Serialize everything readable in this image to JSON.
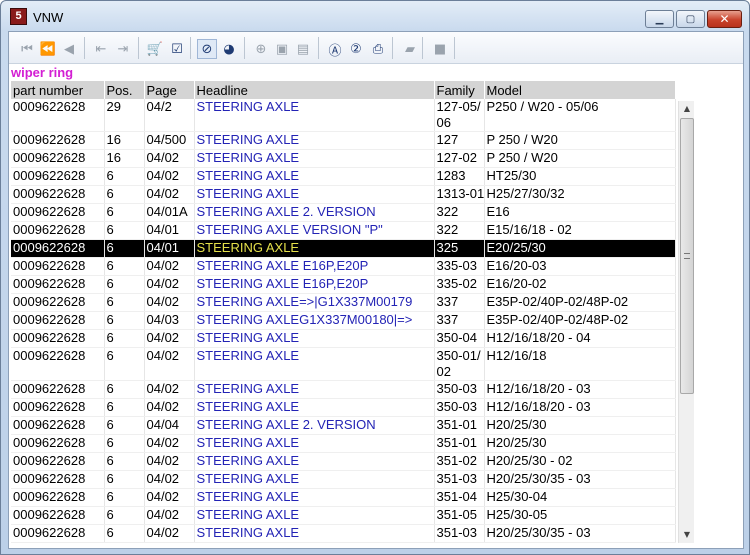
{
  "window": {
    "title": "VNW",
    "app_icon_glyph": "5"
  },
  "toolbar": {
    "buttons": [
      {
        "icon": "first-record-icon",
        "glyph": "⏮",
        "active": false
      },
      {
        "icon": "previous-page-icon",
        "glyph": "⏪",
        "active": false
      },
      {
        "icon": "previous-record-icon",
        "glyph": "◀",
        "active": false
      },
      {
        "icon": "back-document-icon",
        "glyph": "⇤",
        "active": false
      },
      {
        "icon": "forward-document-icon",
        "glyph": "⇥",
        "active": false
      },
      {
        "icon": "cart-icon",
        "glyph": "🛒",
        "active": true
      },
      {
        "icon": "checklist-icon",
        "glyph": "☑",
        "active": true
      },
      {
        "icon": "no-parts-icon",
        "glyph": "⊘",
        "active": true
      },
      {
        "icon": "globe-icon",
        "glyph": "◕",
        "active": true
      },
      {
        "icon": "zoom-icon",
        "glyph": "⊕",
        "active": false
      },
      {
        "icon": "page-icon",
        "glyph": "▣",
        "active": false
      },
      {
        "icon": "page-alt-icon",
        "glyph": "▤",
        "active": false
      },
      {
        "icon": "search-a-icon",
        "glyph": "Ⓐ",
        "active": true
      },
      {
        "icon": "search-2-icon",
        "glyph": "②",
        "active": true
      },
      {
        "icon": "print-icon",
        "glyph": "⎙",
        "active": true
      },
      {
        "icon": "eraser-icon",
        "glyph": "▰",
        "active": false
      },
      {
        "icon": "stop-icon",
        "glyph": "■",
        "active": false
      }
    ]
  },
  "search_title": "wiper ring",
  "table": {
    "headers": [
      "part number",
      "Pos.",
      "Page",
      "Headline",
      "Family",
      "Model"
    ],
    "rows": [
      [
        "0009622628",
        "29",
        "04/2",
        "STEERING AXLE",
        "127-05/06",
        "P250 / W20 - 05/06"
      ],
      [
        "0009622628",
        "16",
        "04/500",
        "STEERING AXLE",
        "127",
        "P 250 / W20"
      ],
      [
        "0009622628",
        "16",
        "04/02",
        "STEERING AXLE",
        "127-02",
        "P 250 / W20"
      ],
      [
        "0009622628",
        "6",
        "04/02",
        "STEERING AXLE",
        "1283",
        "HT25/30"
      ],
      [
        "0009622628",
        "6",
        "04/02",
        "STEERING AXLE",
        "1313-01",
        "H25/27/30/32"
      ],
      [
        "0009622628",
        "6",
        "04/01A",
        "STEERING AXLE 2. VERSION",
        "322",
        "E16"
      ],
      [
        "0009622628",
        "6",
        "04/01",
        "STEERING AXLE VERSION \"P\"",
        "322",
        "E15/16/18 - 02"
      ],
      [
        "0009622628",
        "6",
        "04/01",
        "STEERING AXLE",
        "325",
        "E20/25/30"
      ],
      [
        "0009622628",
        "6",
        "04/02",
        "STEERING AXLE E16P,E20P",
        "335-03",
        "E16/20-03"
      ],
      [
        "0009622628",
        "6",
        "04/02",
        "STEERING AXLE E16P,E20P",
        "335-02",
        "E16/20-02"
      ],
      [
        "0009622628",
        "6",
        "04/02",
        "STEERING AXLE=>|G1X337M00179",
        "337",
        "E35P-02/40P-02/48P-02"
      ],
      [
        "0009622628",
        "6",
        "04/03",
        "STEERING AXLEG1X337M00180|=>",
        "337",
        "E35P-02/40P-02/48P-02"
      ],
      [
        "0009622628",
        "6",
        "04/02",
        "STEERING AXLE",
        "350-04",
        "H12/16/18/20 - 04"
      ],
      [
        "0009622628",
        "6",
        "04/02",
        "STEERING AXLE",
        "350-01/02",
        "H12/16/18"
      ],
      [
        "0009622628",
        "6",
        "04/02",
        "STEERING AXLE",
        "350-03",
        "H12/16/18/20 - 03"
      ],
      [
        "0009622628",
        "6",
        "04/02",
        "STEERING AXLE",
        "350-03",
        "H12/16/18/20 - 03"
      ],
      [
        "0009622628",
        "6",
        "04/04",
        "STEERING AXLE 2. VERSION",
        "351-01",
        "H20/25/30"
      ],
      [
        "0009622628",
        "6",
        "04/02",
        "STEERING AXLE",
        "351-01",
        "H20/25/30"
      ],
      [
        "0009622628",
        "6",
        "04/02",
        "STEERING AXLE",
        "351-02",
        "H20/25/30 - 02"
      ],
      [
        "0009622628",
        "6",
        "04/02",
        "STEERING AXLE",
        "351-03",
        "H20/25/30/35 - 03"
      ],
      [
        "0009622628",
        "6",
        "04/02",
        "STEERING AXLE",
        "351-04",
        "H25/30-04"
      ],
      [
        "0009622628",
        "6",
        "04/02",
        "STEERING AXLE",
        "351-05",
        "H25/30-05"
      ],
      [
        "0009622628",
        "6",
        "04/02",
        "STEERING AXLE",
        "351-03",
        "H20/25/30/35 - 03"
      ]
    ],
    "selected_row": 7
  },
  "colors": {
    "search_title": "#d31ed3",
    "headline_link": "#2323b5",
    "selected_bg": "#000000",
    "selected_headline": "#e5e04a"
  }
}
